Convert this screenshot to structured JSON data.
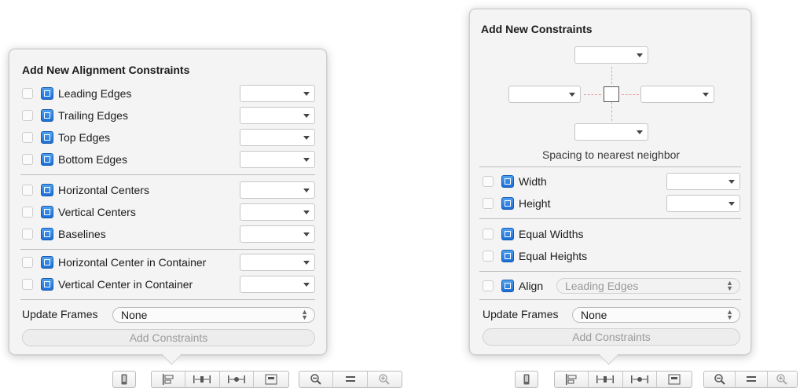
{
  "align_popover": {
    "title": "Add New Alignment Constraints",
    "rows": [
      {
        "label": "Leading Edges",
        "icon": "align-leading-edges-icon"
      },
      {
        "label": "Trailing Edges",
        "icon": "align-trailing-edges-icon"
      },
      {
        "label": "Top Edges",
        "icon": "align-top-edges-icon"
      },
      {
        "label": "Bottom Edges",
        "icon": "align-bottom-edges-icon"
      },
      {
        "label": "Horizontal Centers",
        "icon": "align-horizontal-centers-icon"
      },
      {
        "label": "Vertical Centers",
        "icon": "align-vertical-centers-icon"
      },
      {
        "label": "Baselines",
        "icon": "align-baselines-icon"
      },
      {
        "label": "Horizontal Center in Container",
        "icon": "center-x-in-container-icon"
      },
      {
        "label": "Vertical Center in Container",
        "icon": "center-y-in-container-icon"
      }
    ],
    "update_frames_label": "Update Frames",
    "update_frames_value": "None",
    "add_button": "Add Constraints"
  },
  "pin_popover": {
    "title": "Add New Constraints",
    "spacing_label": "Spacing to nearest neighbor",
    "size_rows": [
      {
        "label": "Width",
        "icon": "width-constraint-icon"
      },
      {
        "label": "Height",
        "icon": "height-constraint-icon"
      }
    ],
    "equal_rows": [
      {
        "label": "Equal Widths",
        "icon": "equal-widths-icon"
      },
      {
        "label": "Equal Heights",
        "icon": "equal-heights-icon"
      }
    ],
    "align_label": "Align",
    "align_value": "Leading Edges",
    "update_frames_label": "Update Frames",
    "update_frames_value": "None",
    "add_button": "Add Constraints"
  },
  "toolbar_icons": [
    "device-icon",
    "align-icon",
    "pin-icon",
    "resolve-icon",
    "resizing-icon",
    "zoom-out-icon",
    "actual-size-icon",
    "zoom-in-icon"
  ]
}
